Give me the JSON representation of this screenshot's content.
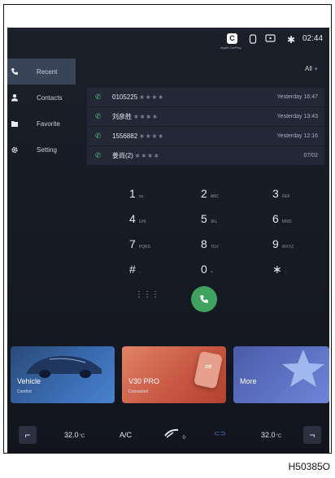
{
  "statusbar": {
    "carplay_label": "Apple CarPlay",
    "time": "02:44",
    "icons": [
      "carplay-icon",
      "phone-icon",
      "screen-mirror-icon",
      "bluetooth-icon"
    ]
  },
  "sidebar": {
    "items": [
      {
        "label": "Recent",
        "icon": "phone-icon",
        "active": true
      },
      {
        "label": "Contacts",
        "icon": "person-icon",
        "active": false
      },
      {
        "label": "Favorite",
        "icon": "folder-icon",
        "active": false
      },
      {
        "label": "Setting",
        "icon": "gear-icon",
        "active": false
      }
    ]
  },
  "filter": {
    "label": "All"
  },
  "calls": [
    {
      "number": "0105225",
      "mask": "∗∗∗∗",
      "time": "Yesterday 16:47"
    },
    {
      "number": "刘彦胜",
      "mask": "∗∗∗∗",
      "time": "Yesterday 13:43"
    },
    {
      "number": "1556882",
      "mask": "∗∗∗∗",
      "time": "Yesterday 12:16"
    },
    {
      "number": "姜尚(2)",
      "mask": "∗∗∗∗",
      "time": "07/02"
    }
  ],
  "dialpad": [
    {
      "digit": "1",
      "letters": "ᴏᴏ"
    },
    {
      "digit": "2",
      "letters": "ABC"
    },
    {
      "digit": "3",
      "letters": "DEF"
    },
    {
      "digit": "4",
      "letters": "GHI"
    },
    {
      "digit": "5",
      "letters": "JKL"
    },
    {
      "digit": "6",
      "letters": "MNO"
    },
    {
      "digit": "7",
      "letters": "PQRS"
    },
    {
      "digit": "8",
      "letters": "TUV"
    },
    {
      "digit": "9",
      "letters": "WXYZ"
    },
    {
      "digit": "#",
      "letters": ","
    },
    {
      "digit": "0",
      "letters": "+"
    },
    {
      "digit": "∗",
      "letters": ";"
    }
  ],
  "cards": {
    "vehicle": {
      "title": "Vehicle",
      "sub": "Comfort"
    },
    "v30": {
      "title": "V30 PRO",
      "sub": "Connected"
    },
    "more": {
      "title": "More"
    }
  },
  "climate": {
    "left_temp": "32.0",
    "right_temp": "32.0",
    "unit": "°C",
    "ac_label": "A/C",
    "fan_level": "0"
  },
  "footer_code": "H50385O",
  "colors": {
    "accent_green": "#3fa35f",
    "vehicle_card": "#3b6db3",
    "v30_card": "#c65542",
    "more_card": "#6e86d8"
  }
}
